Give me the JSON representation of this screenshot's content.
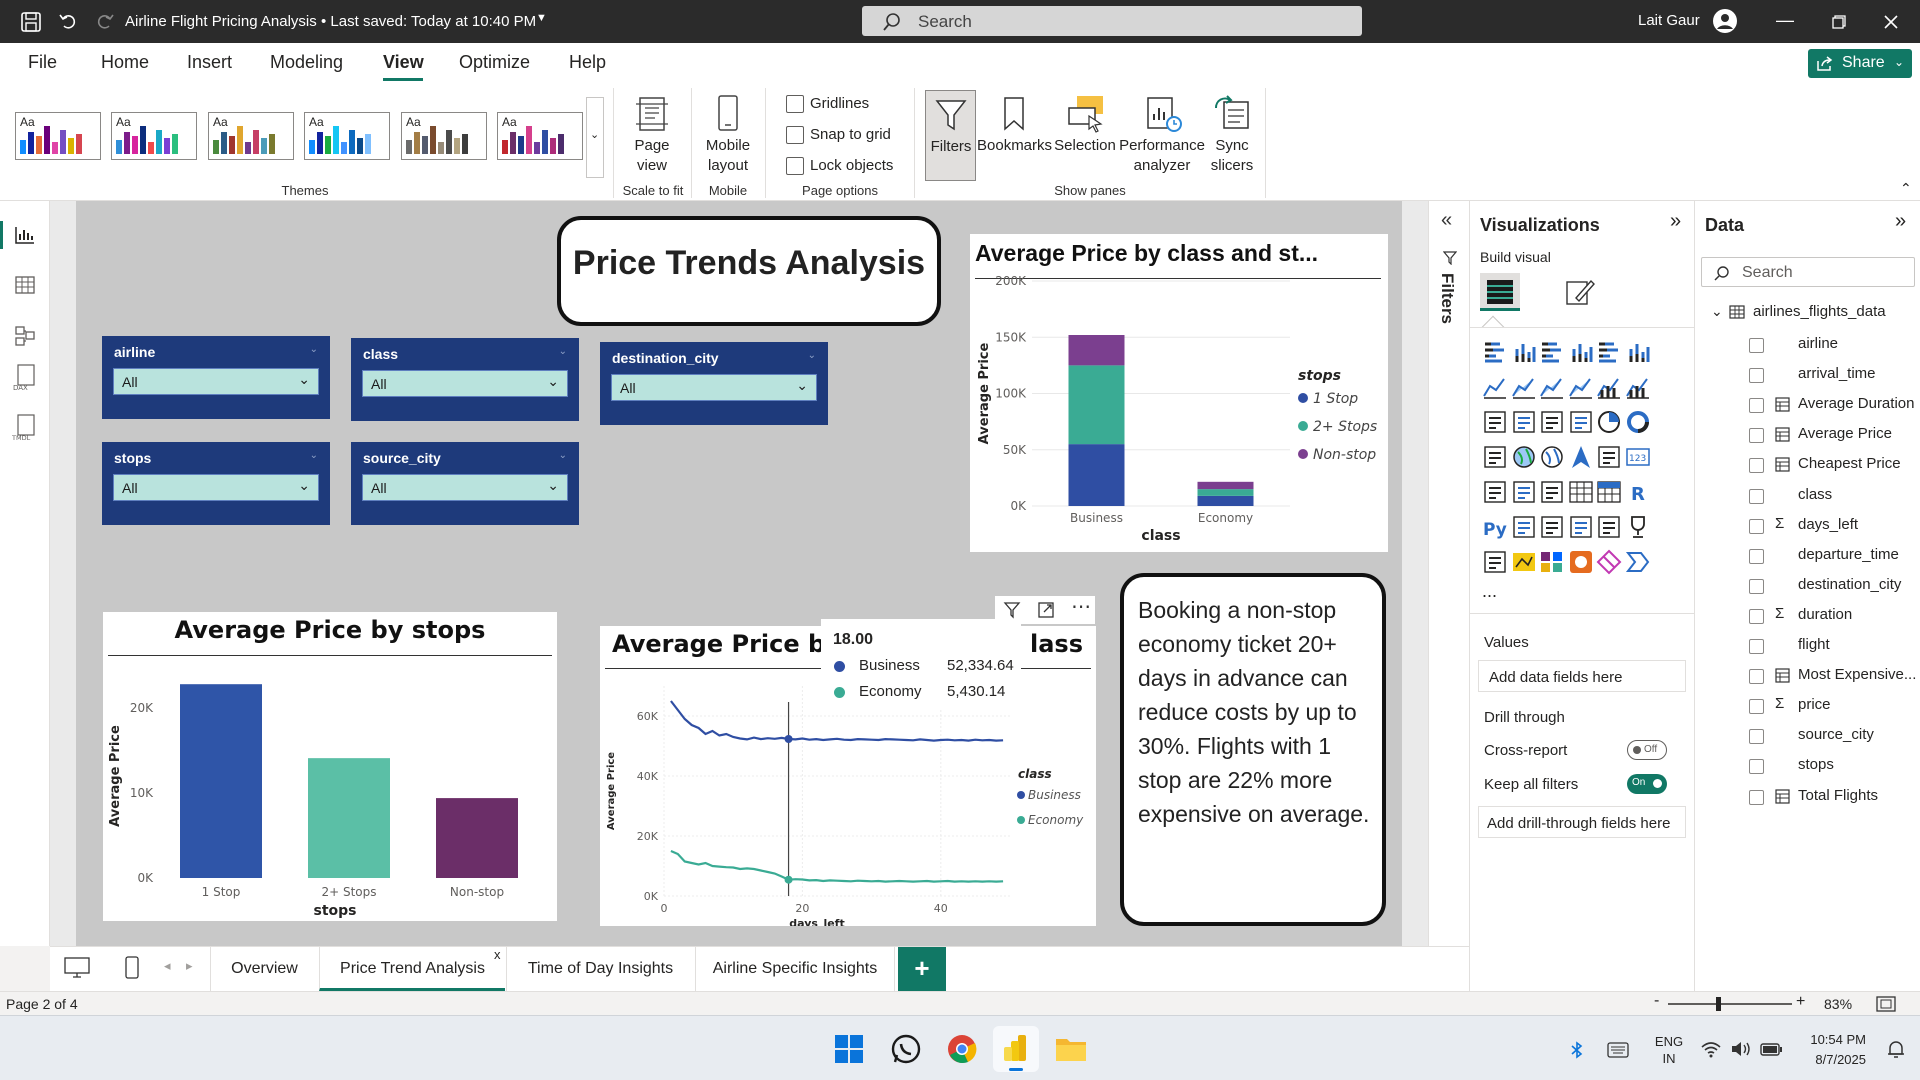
{
  "titlebar": {
    "title": "Airline Flight Pricing Analysis",
    "saved": "• Last saved: Today at 10:40 PM",
    "search_placeholder": "Search",
    "user": "Lait Gaur"
  },
  "ribbon_tabs": [
    "File",
    "Home",
    "Insert",
    "Modeling",
    "View",
    "Optimize",
    "Help"
  ],
  "active_tab": "View",
  "share_label": "Share",
  "ribbon": {
    "themes_label": "Themes",
    "theme_aa": "Aa",
    "page_view": {
      "line1": "Page",
      "line2": "view"
    },
    "scale_label": "Scale to fit",
    "mobile": {
      "line1": "Mobile",
      "line2": "layout"
    },
    "mobile_label": "Mobile",
    "gridlines": "Gridlines",
    "snap": "Snap to grid",
    "lock": "Lock objects",
    "page_options_label": "Page options",
    "filters": "Filters",
    "bookmarks": "Bookmarks",
    "selection": "Selection",
    "performance": {
      "line1": "Performance",
      "line2": "analyzer"
    },
    "sync": {
      "line1": "Sync",
      "line2": "slicers"
    },
    "show_panes_label": "Show panes"
  },
  "report": {
    "title": "Price Trends Analysis",
    "slicers": [
      {
        "label": "airline",
        "value": "All"
      },
      {
        "label": "class",
        "value": "All"
      },
      {
        "label": "destination_city",
        "value": "All"
      },
      {
        "label": "stops",
        "value": "All"
      },
      {
        "label": "source_city",
        "value": "All"
      }
    ],
    "insight": "Booking a non-stop economy ticket 20+ days in advance can reduce costs by up to 30%. Flights with 1 stop are 22% more expensive on average.",
    "tooltip": {
      "header": "18.00",
      "rows": [
        {
          "name": "Business",
          "value": "52,334.64",
          "color": "#2f4ea3"
        },
        {
          "name": "Economy",
          "value": "5,430.14",
          "color": "#3aab94"
        }
      ]
    }
  },
  "chart_data": [
    {
      "type": "bar",
      "title": "Average Price by class and st...",
      "xlabel": "class",
      "ylabel": "Average Price",
      "ylim": [
        0,
        200000
      ],
      "yticks": [
        "0K",
        "50K",
        "100K",
        "150K",
        "200K"
      ],
      "categories": [
        "Business",
        "Economy"
      ],
      "legend_title": "stops",
      "legend_position": "right",
      "stacked": true,
      "series": [
        {
          "name": "1 Stop",
          "color": "#2f4ea3",
          "values": [
            55000,
            9000
          ]
        },
        {
          "name": "2+ Stops",
          "color": "#3aab94",
          "values": [
            70000,
            6000
          ]
        },
        {
          "name": "Non-stop",
          "color": "#7b3f8f",
          "values": [
            27000,
            6500
          ]
        }
      ]
    },
    {
      "type": "bar",
      "title": "Average Price by stops",
      "xlabel": "stops",
      "ylabel": "Average Price",
      "ylim": [
        0,
        24000
      ],
      "yticks": [
        "0K",
        "10K",
        "20K"
      ],
      "categories": [
        "1 Stop",
        "2+ Stops",
        "Non-stop"
      ],
      "values": [
        22800,
        14100,
        9400
      ],
      "colors": [
        "#2f55a8",
        "#5bbfa6",
        "#6b2e68"
      ]
    },
    {
      "type": "line",
      "title_left": "Average Price by",
      "title_right": "lass",
      "xlabel": "days_left",
      "ylabel": "Average Price",
      "xlim": [
        0,
        50
      ],
      "ylim": [
        0,
        70000
      ],
      "xticks": [
        "0",
        "20",
        "40"
      ],
      "yticks": [
        "0K",
        "20K",
        "40K",
        "60K"
      ],
      "legend_title": "class",
      "legend_position": "right",
      "x": [
        1,
        2,
        3,
        4,
        5,
        6,
        7,
        8,
        9,
        10,
        11,
        12,
        13,
        14,
        15,
        16,
        17,
        18,
        19,
        20,
        21,
        22,
        23,
        24,
        25,
        26,
        27,
        28,
        29,
        30,
        31,
        32,
        33,
        34,
        35,
        36,
        37,
        38,
        39,
        40,
        41,
        42,
        43,
        44,
        45,
        46,
        47,
        48,
        49
      ],
      "series": [
        {
          "name": "Business",
          "color": "#2f4ea3",
          "values": [
            65000,
            62000,
            59000,
            57000,
            56000,
            54000,
            55000,
            53500,
            54000,
            53000,
            52500,
            52200,
            52800,
            52300,
            52600,
            52400,
            52700,
            52334,
            52200,
            52500,
            52100,
            52300,
            52000,
            52200,
            52400,
            52100,
            52000,
            52300,
            52200,
            52100,
            52000,
            52300,
            52200,
            52100,
            52000,
            51900,
            52200,
            52000,
            51800,
            52000,
            52100,
            51900,
            52000,
            51800,
            52100,
            51900,
            52000,
            51800,
            51900
          ],
          "dashed_from": 20
        },
        {
          "name": "Economy",
          "color": "#3aab94",
          "values": [
            15000,
            14000,
            11500,
            11000,
            10500,
            11000,
            10000,
            9800,
            9600,
            9500,
            9000,
            9200,
            9000,
            8500,
            8000,
            7500,
            6500,
            5430,
            5600,
            5500,
            5200,
            5300,
            5000,
            5200,
            5100,
            5000,
            4900,
            5100,
            5000,
            4900,
            5000,
            4800,
            4900,
            5000,
            4900,
            4800,
            4900,
            5000,
            4800,
            4900,
            5000,
            4800,
            4900,
            4800,
            4900,
            4800,
            4900,
            4800,
            4900
          ]
        }
      ]
    }
  ],
  "visualizations_pane": {
    "title": "Visualizations",
    "build_visual": "Build visual",
    "values_label": "Values",
    "add_data_fields": "Add data fields here",
    "drill_through": "Drill through",
    "cross_report": "Cross-report",
    "cross_report_state": "Off",
    "keep_all_filters": "Keep all filters",
    "keep_all_filters_state": "On",
    "add_drill_fields": "Add drill-through fields here",
    "more": "..."
  },
  "filters_label": "Filters",
  "data_pane": {
    "title": "Data",
    "search_placeholder": "Search",
    "table_name": "airlines_flights_data",
    "fields": [
      {
        "name": "airline",
        "kind": "field"
      },
      {
        "name": "arrival_time",
        "kind": "field"
      },
      {
        "name": "Average Duration",
        "kind": "measure"
      },
      {
        "name": "Average Price",
        "kind": "measure"
      },
      {
        "name": "Cheapest Price",
        "kind": "measure"
      },
      {
        "name": "class",
        "kind": "field"
      },
      {
        "name": "days_left",
        "kind": "sum"
      },
      {
        "name": "departure_time",
        "kind": "field"
      },
      {
        "name": "destination_city",
        "kind": "field"
      },
      {
        "name": "duration",
        "kind": "sum"
      },
      {
        "name": "flight",
        "kind": "field"
      },
      {
        "name": "Most Expensive...",
        "kind": "measure"
      },
      {
        "name": "price",
        "kind": "sum"
      },
      {
        "name": "source_city",
        "kind": "field"
      },
      {
        "name": "stops",
        "kind": "field"
      },
      {
        "name": "Total Flights",
        "kind": "measure"
      }
    ]
  },
  "page_tabs": [
    "Overview",
    "Price Trend Analysis",
    "Time of Day Insights",
    "Airline Specific Insights"
  ],
  "active_page": "Price Trend Analysis",
  "status": {
    "page": "Page 2 of 4",
    "zoom": "83%"
  },
  "taskbar": {
    "lang1": "ENG",
    "lang2": "IN",
    "time": "10:54 PM",
    "date": "8/7/2025"
  }
}
